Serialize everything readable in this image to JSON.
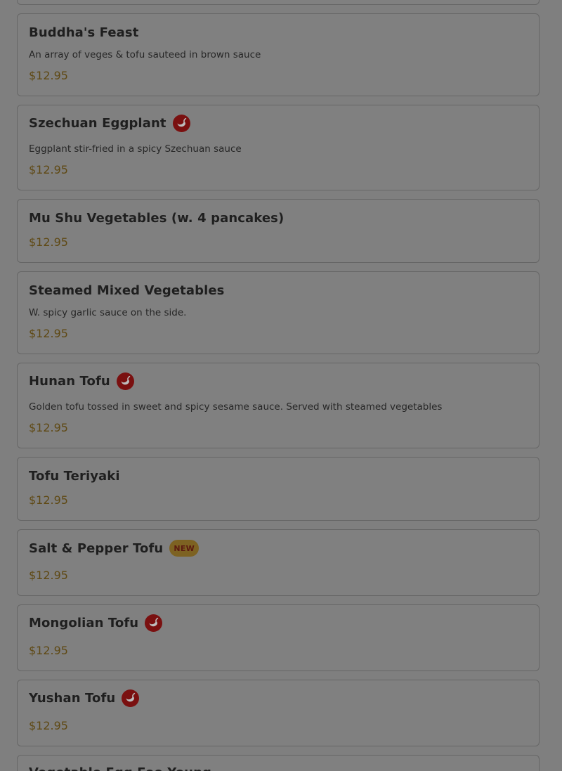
{
  "icons": {
    "spicy": "chili-pepper-icon"
  },
  "colors": {
    "overlay_background": "#7f7f7f",
    "card_border": "#666666",
    "price": "#5f4914",
    "spicy_badge": "#7a1010",
    "new_badge": "#7d6222"
  },
  "menu": {
    "items": [
      {
        "title": "Buddha's Feast",
        "description": "An array of veges & tofu sauteed in brown sauce",
        "price": "$12.95"
      },
      {
        "title": "Szechuan Eggplant",
        "description": "Eggplant stir-fried in a spicy Szechuan sauce",
        "price": "$12.95",
        "spicy": true
      },
      {
        "title": "Mu Shu Vegetables (w. 4 pancakes)",
        "price": "$12.95"
      },
      {
        "title": "Steamed Mixed Vegetables",
        "description": "W. spicy garlic sauce on the side.",
        "price": "$12.95"
      },
      {
        "title": "Hunan Tofu",
        "description": "Golden tofu tossed in sweet and spicy sesame sauce. Served with steamed vegetables",
        "price": "$12.95",
        "spicy": true
      },
      {
        "title": "Tofu Teriyaki",
        "price": "$12.95"
      },
      {
        "title": "Salt & Pepper Tofu",
        "price": "$12.95",
        "badge": "NEW"
      },
      {
        "title": "Mongolian Tofu",
        "price": "$12.95",
        "spicy": true
      },
      {
        "title": "Yushan Tofu",
        "price": "$12.95",
        "spicy": true
      },
      {
        "title": "Vegetable Egg Foo Young"
      }
    ]
  }
}
